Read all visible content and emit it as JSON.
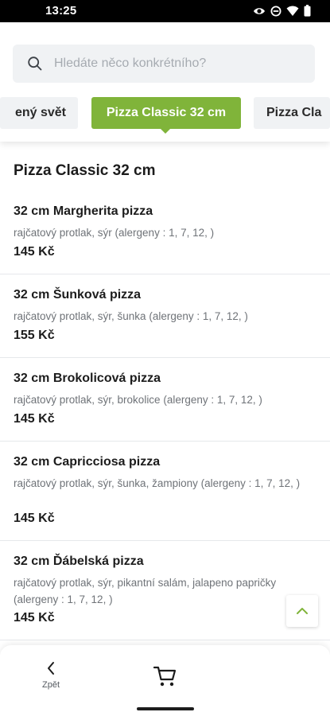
{
  "status_bar": {
    "time": "13:25"
  },
  "search": {
    "placeholder": "Hledáte něco konkrétního?"
  },
  "categories": [
    {
      "label": "ený svět",
      "active": false
    },
    {
      "label": "Pizza Classic 32 cm",
      "active": true
    },
    {
      "label": "Pizza Cla",
      "active": false
    }
  ],
  "section": {
    "title": "Pizza Classic 32 cm"
  },
  "items": [
    {
      "name": "32 cm Margherita pizza",
      "desc": "rajčatový protlak, sýr (alergeny : 1, 7, 12, )",
      "price": "145 Kč"
    },
    {
      "name": "32 cm Šunková pizza",
      "desc": "rajčatový protlak, sýr, šunka (alergeny : 1, 7, 12, )",
      "price": "155 Kč"
    },
    {
      "name": "32 cm Brokolicová pizza",
      "desc": "rajčatový protlak, sýr, brokolice (alergeny : 1, 7, 12, )",
      "price": "145 Kč"
    },
    {
      "name": "32 cm Capricciosa pizza",
      "desc": "rajčatový protlak, sýr, šunka, žampiony (alergeny : 1, 7, 12, )",
      "price": "145 Kč"
    },
    {
      "name": "32 cm Ďábelská pizza",
      "desc": "rajčatový protlak, sýr, pikantní salám, jalapeno papričky (alergeny : 1, 7, 12, )",
      "price": "145 Kč"
    }
  ],
  "bottom_nav": {
    "back_label": "Zpět"
  },
  "colors": {
    "accent": "#80b43a",
    "tab_inactive": "#f0f2f4",
    "text_secondary": "#6f7378"
  }
}
